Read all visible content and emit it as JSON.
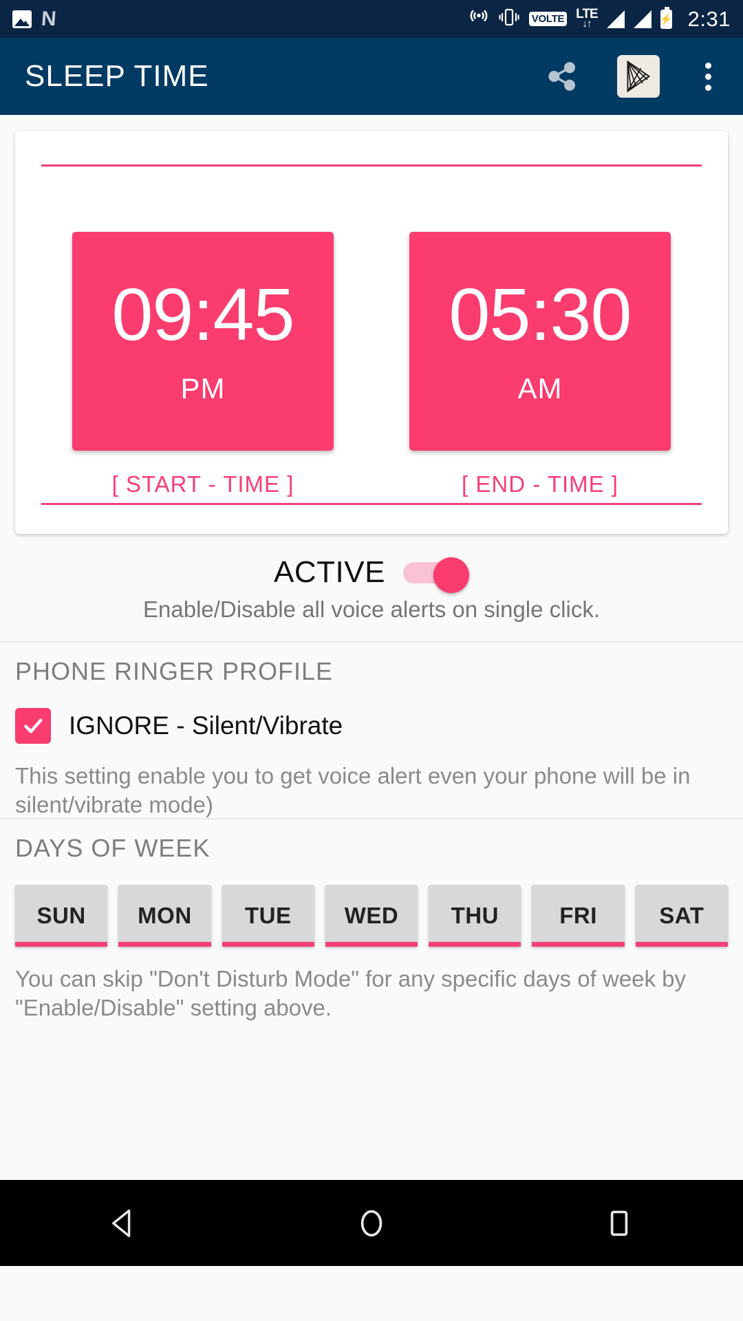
{
  "statusbar": {
    "icons": [
      "image-icon",
      "netflix-icon",
      "hotspot-icon",
      "vibrate-icon",
      "volte-icon",
      "lte-icon",
      "signal-icon",
      "signal-icon",
      "battery-charging-icon"
    ],
    "volte_label": "VOLTE",
    "lte_label": "LTE",
    "lte_arrows": "↓↑",
    "battery_glyph": "⚡",
    "clock": "2:31"
  },
  "appbar": {
    "title": "SLEEP TIME",
    "share_label": "share-icon",
    "play_label": "play-store-icon",
    "overflow_label": "more-options-icon"
  },
  "time_card": {
    "start": {
      "time": "09:45",
      "meridiem": "PM",
      "label": "[ START - TIME ]"
    },
    "end": {
      "time": "05:30",
      "meridiem": "AM",
      "label": "[ END - TIME ]"
    }
  },
  "active": {
    "label": "ACTIVE",
    "toggle_on": true,
    "description": "Enable/Disable all voice alerts on single click."
  },
  "ringer": {
    "title": "PHONE RINGER PROFILE",
    "checkbox_checked": true,
    "checkbox_glyph": "✓",
    "checkbox_label": "IGNORE - Silent/Vibrate",
    "description": "This setting enable you to get voice alert even your phone will be in silent/vibrate mode)"
  },
  "days": {
    "title": "DAYS OF WEEK",
    "items": [
      {
        "label": "SUN"
      },
      {
        "label": "MON"
      },
      {
        "label": "TUE"
      },
      {
        "label": "WED"
      },
      {
        "label": "THU"
      },
      {
        "label": "FRI"
      },
      {
        "label": "SAT"
      }
    ],
    "description": "You can skip \"Don't Disturb Mode\" for any specific days of week by \"Enable/Disable\" setting above."
  },
  "navbar": {
    "back_label": "back-icon",
    "home_label": "home-icon",
    "recents_label": "recents-icon"
  },
  "colors": {
    "accent_pink": "#fa3c6e",
    "rule_pink": "#f43f77",
    "appbar_blue": "#013a63",
    "statusbar_blue": "#0b2545",
    "page_bg": "#fafafa",
    "day_button": "#d8d8d8"
  }
}
